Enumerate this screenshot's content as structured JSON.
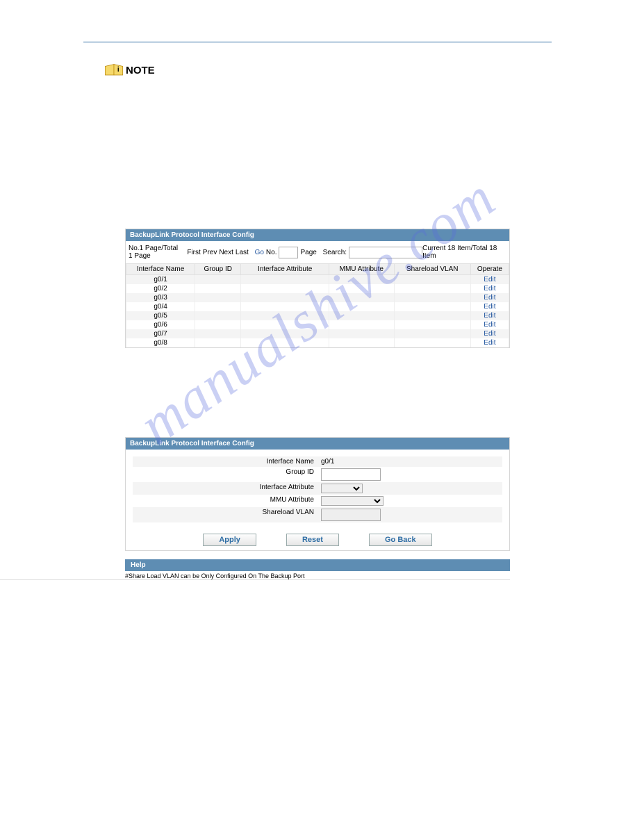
{
  "note_label": "NOTE",
  "watermark": "manualshive.com",
  "panel1": {
    "title": "BackupLink Protocol Interface Config",
    "pager_text": "No.1 Page/Total 1 Page",
    "nav": {
      "first": "First",
      "prev": "Prev",
      "next": "Next",
      "last": "Last",
      "go": "Go",
      "no": "No.",
      "page": "Page",
      "search": "Search:"
    },
    "status": "Current 18 Item/Total 18 Item",
    "headers": [
      "Interface Name",
      "Group ID",
      "Interface Attribute",
      "MMU Attribute",
      "Shareload VLAN",
      "Operate"
    ],
    "rows": [
      {
        "name": "g0/1",
        "op": "Edit"
      },
      {
        "name": "g0/2",
        "op": "Edit"
      },
      {
        "name": "g0/3",
        "op": "Edit"
      },
      {
        "name": "g0/4",
        "op": "Edit"
      },
      {
        "name": "g0/5",
        "op": "Edit"
      },
      {
        "name": "g0/6",
        "op": "Edit"
      },
      {
        "name": "g0/7",
        "op": "Edit"
      },
      {
        "name": "g0/8",
        "op": "Edit"
      }
    ]
  },
  "panel2": {
    "title": "BackupLink Protocol Interface Config",
    "fields": {
      "interface_name": {
        "label": "Interface Name",
        "value": "g0/1"
      },
      "group_id": {
        "label": "Group ID"
      },
      "interface_attribute": {
        "label": "Interface Attribute"
      },
      "mmu_attribute": {
        "label": "MMU Attribute"
      },
      "shareload_vlan": {
        "label": "Shareload VLAN"
      }
    },
    "buttons": {
      "apply": "Apply",
      "reset": "Reset",
      "goback": "Go Back"
    }
  },
  "help": {
    "title": "Help",
    "text": "#Share Load VLAN can be Only Configured On The Backup Port"
  }
}
